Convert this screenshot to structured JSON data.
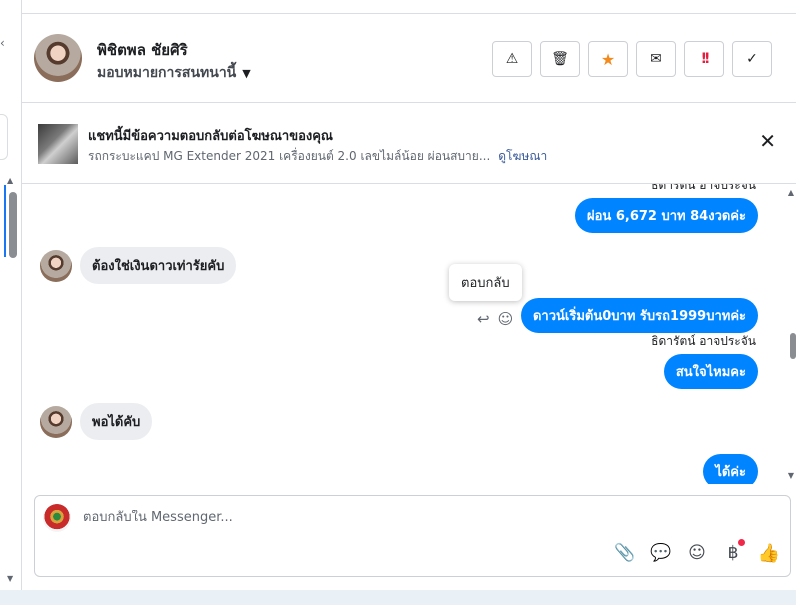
{
  "left_strip": {
    "chevron": "‹"
  },
  "header": {
    "name": "พิชิตพล ชัยศิริ",
    "assign_label": "มอบหมายการสนทนานี้",
    "caret_icon": "▼",
    "actions": [
      {
        "name": "spam-button",
        "glyph": "⚠"
      },
      {
        "name": "delete-button",
        "glyph": "🗑"
      },
      {
        "name": "star-button",
        "glyph": "★"
      },
      {
        "name": "mark-unread-button",
        "glyph": "✉"
      },
      {
        "name": "follow-up-button",
        "glyph": "!!"
      },
      {
        "name": "done-button",
        "glyph": "✓"
      }
    ]
  },
  "ad_banner": {
    "title": "แชทนี้มีข้อความตอบกลับต่อโฆษณาของคุณ",
    "subtitle": "รถกระบะแคป MG Extender 2021 เครื่องยนต์ 2.0 เลขไมล์น้อย ผ่อนสบาย...",
    "link": "ดูโฆษณา",
    "close_glyph": "✕"
  },
  "messages": {
    "top_sender_partial": "ธิดารัตน์ อาจประจัน",
    "items": [
      {
        "direction": "out",
        "text": "ผ่อน 6,672 บาท 84งวดค่ะ"
      },
      {
        "direction": "in",
        "text": "ต้องใช่เงินดาวเท่ารัยคับ"
      },
      {
        "direction": "out",
        "text": "ดาวน์เริ่มต้น0บาท รับรถ1999บาทค่ะ"
      },
      {
        "direction": "out",
        "text": "สนใจไหมคะ",
        "sender": "ธิดารัตน์ อาจประจัน"
      },
      {
        "direction": "in",
        "text": "พอได้คับ"
      },
      {
        "direction": "out",
        "text": "ได้ค่ะ"
      }
    ],
    "tooltip": "ตอบกลับ",
    "reply_icon": "↩",
    "react_icon": "☺"
  },
  "composer": {
    "placeholder": "ตอบกลับใน Messenger...",
    "tools": [
      {
        "name": "attach-icon",
        "glyph": "📎"
      },
      {
        "name": "saved-replies-icon",
        "glyph": "💬"
      },
      {
        "name": "emoji-icon",
        "glyph": "☺"
      },
      {
        "name": "payment-icon",
        "glyph": "฿"
      },
      {
        "name": "thumbs-up-icon",
        "glyph": "👍"
      }
    ]
  },
  "colors": {
    "accent": "#0084ff",
    "link": "#385898",
    "incoming_bubble": "#ebedf0"
  }
}
